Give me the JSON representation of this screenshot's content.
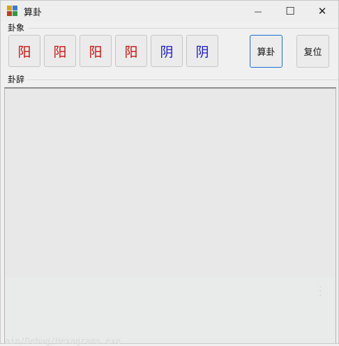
{
  "window": {
    "title": "算卦",
    "controls": {
      "minimize": "—",
      "maximize": "☐",
      "close": "✕"
    }
  },
  "colors": {
    "yang": "#cc1111",
    "yin": "#1a1ad0"
  },
  "hexagram_group": {
    "label": "卦象",
    "lines": [
      {
        "label": "阳",
        "kind": "yang"
      },
      {
        "label": "阳",
        "kind": "yang"
      },
      {
        "label": "阳",
        "kind": "yang"
      },
      {
        "label": "阳",
        "kind": "yang"
      },
      {
        "label": "阴",
        "kind": "yin"
      },
      {
        "label": "阴",
        "kind": "yin"
      }
    ]
  },
  "actions": {
    "divine_label": "算卦",
    "reset_label": "复位"
  },
  "result_group": {
    "label": "卦辞",
    "content": ""
  },
  "background_ghost": {
    "path_text": "ain/Debug/Hexagrams.exe"
  }
}
